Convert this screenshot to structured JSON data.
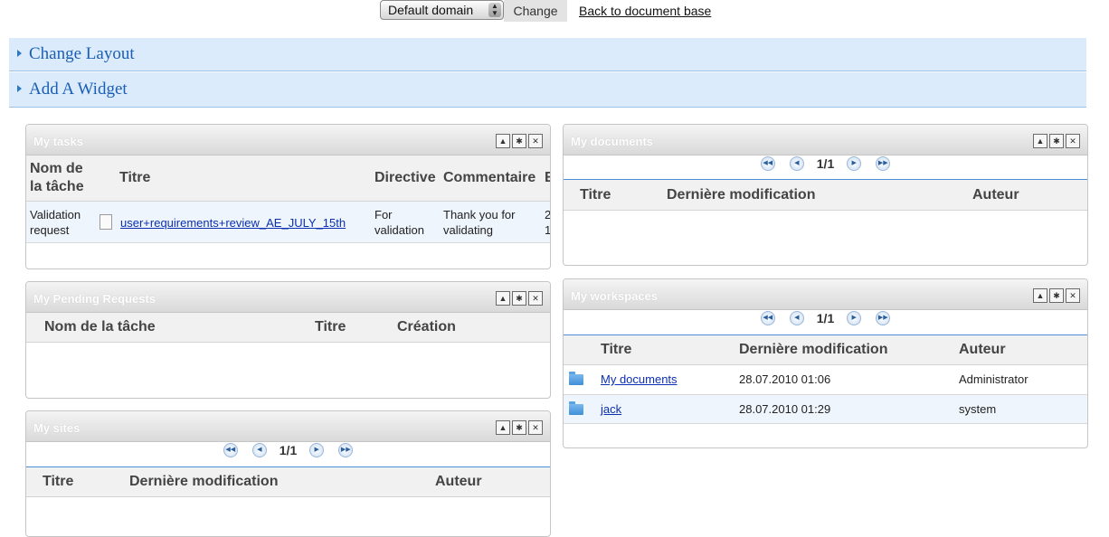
{
  "topbar": {
    "domain_value": "Default domain",
    "change_label": "Change",
    "back_label": "Back to document base"
  },
  "bars": {
    "change_layout": "Change Layout",
    "add_widget": "Add A Widget"
  },
  "my_tasks": {
    "title": "My tasks",
    "columns": [
      "Nom de\nla tâche",
      "Titre",
      "Directive",
      "Commentaire",
      "E"
    ],
    "row": {
      "task_line1": "Validation",
      "task_line2": "request",
      "title": "user+requirements+review_AE_JULY_15th",
      "directive_line1": "For",
      "directive_line2": "validation",
      "comment_line1": "Thank you for",
      "comment_line2": "validating",
      "extra_line1": "2",
      "extra_line2": "1"
    }
  },
  "my_documents": {
    "title": "My documents",
    "pager": "1/1",
    "columns": [
      "Titre",
      "Dernière modification",
      "Auteur"
    ]
  },
  "my_pending": {
    "title": "My Pending Requests",
    "columns": [
      "Nom de la tâche",
      "Titre",
      "Création"
    ]
  },
  "my_workspaces": {
    "title": "My workspaces",
    "pager": "1/1",
    "columns": [
      "Titre",
      "Dernière modification",
      "Auteur"
    ],
    "rows": [
      {
        "title": "My documents",
        "modified": "28.07.2010 01:06",
        "author": "Administrator"
      },
      {
        "title": "jack",
        "modified": "28.07.2010 01:29",
        "author": "system"
      }
    ]
  },
  "my_sites": {
    "title": "My sites",
    "pager": "1/1",
    "columns": [
      "Titre",
      "Dernière modification",
      "Auteur"
    ]
  },
  "icons": {
    "collapse": "collapse-icon",
    "settings": "gear-icon",
    "close": "close-icon",
    "first": "first-page-icon",
    "prev": "previous-page-icon",
    "next": "next-page-icon",
    "last": "last-page-icon"
  }
}
